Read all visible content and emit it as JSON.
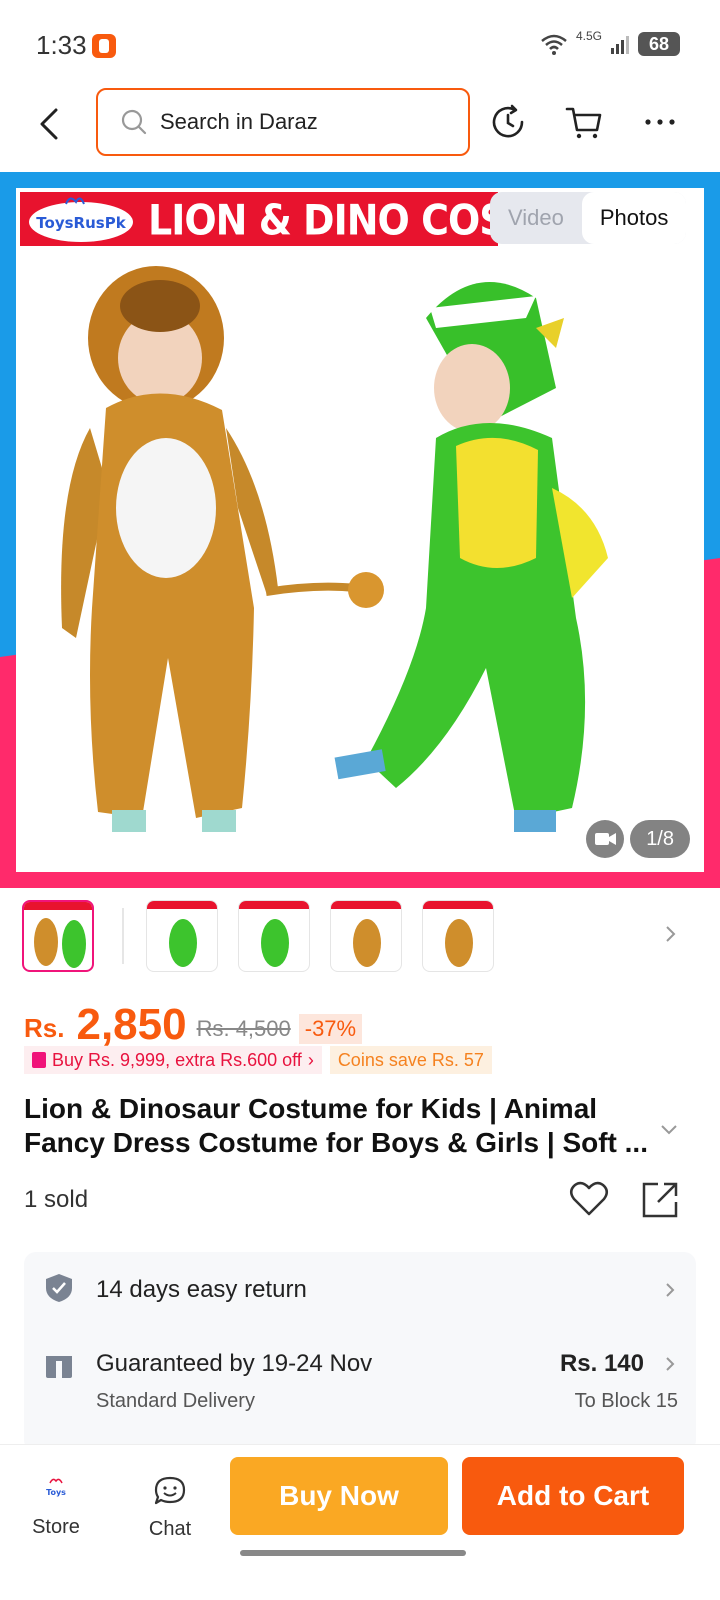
{
  "status": {
    "time": "1:33",
    "network": "4.5G",
    "battery": "68"
  },
  "header": {
    "search_placeholder": "Search in Daraz"
  },
  "gallery": {
    "banner_text": "LION & DINO COSTU",
    "logo_text": "ToysRusPk",
    "tabs": [
      "Video",
      "Photos"
    ],
    "counter": "1/8",
    "thumbnail_count": 5,
    "active_thumbnail": 1,
    "colors": {
      "left_band": "#1a9be8",
      "right_band": "#ff2a6b",
      "banner": "#e8132e"
    }
  },
  "product": {
    "currency": "Rs.",
    "price": "2,850",
    "original_price": "Rs. 4,500",
    "discount": "-37%",
    "promo": "Buy Rs. 9,999, extra Rs.600 off",
    "coins": "Coins save Rs. 57",
    "title": "Lion & Dinosaur Costume for Kids | Animal Fancy Dress Costume for Boys & Girls | Soft ...",
    "sold": "1 sold"
  },
  "services": {
    "return": "14 days easy return",
    "delivery_title": "Guaranteed by 19-24 Nov",
    "delivery_sub": "Standard Delivery",
    "delivery_price": "Rs. 140",
    "delivery_to": "To Block 15"
  },
  "bottom_bar": {
    "store": "Store",
    "chat": "Chat",
    "buy_now": "Buy Now",
    "add_to_cart": "Add to Cart"
  },
  "theme": {
    "accent": "#f85a0e",
    "buy_now": "#faa823",
    "pink": "#f0147a"
  }
}
